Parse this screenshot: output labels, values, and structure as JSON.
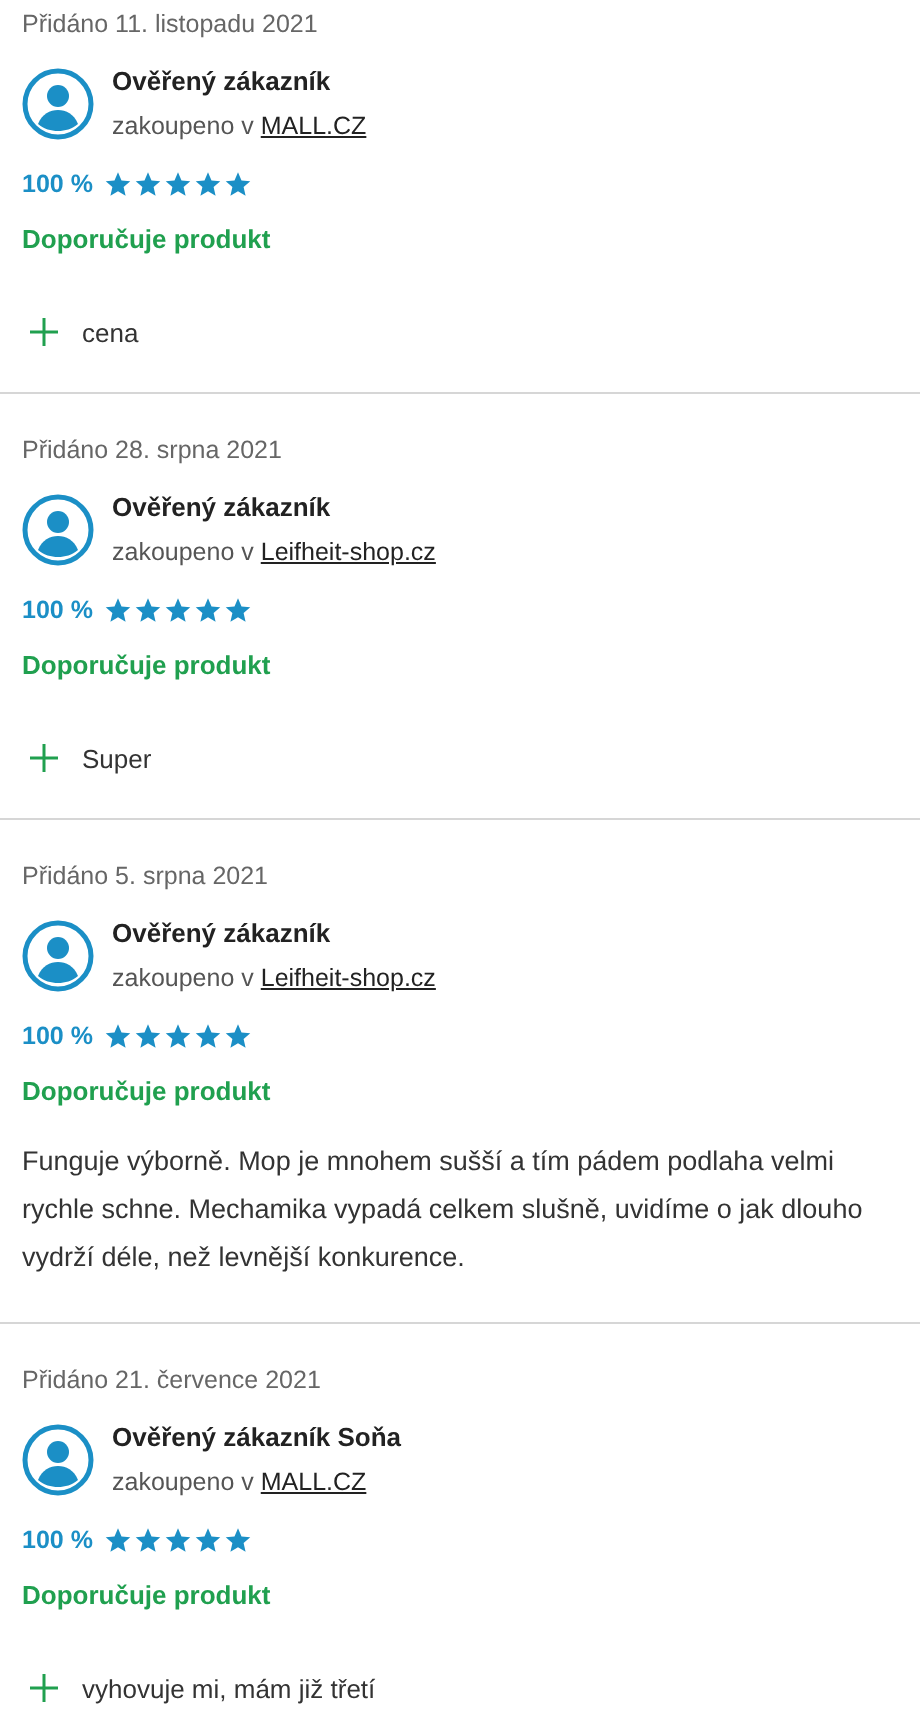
{
  "reviews": [
    {
      "date": "Přidáno 11. listopadu 2021",
      "author": "Ověřený zákazník",
      "purchased_prefix": "zakoupeno v",
      "shop": "MALL.CZ",
      "rating": "100 %",
      "stars": 5,
      "recommend": "Doporučuje produkt",
      "pros": [
        "cena"
      ]
    },
    {
      "date": "Přidáno 28. srpna 2021",
      "author": "Ověřený zákazník",
      "purchased_prefix": "zakoupeno v",
      "shop": "Leifheit-shop.cz",
      "rating": "100 %",
      "stars": 5,
      "recommend": "Doporučuje produkt",
      "pros": [
        "Super"
      ]
    },
    {
      "date": "Přidáno 5. srpna 2021",
      "author": "Ověřený zákazník",
      "purchased_prefix": "zakoupeno v",
      "shop": "Leifheit-shop.cz",
      "rating": "100 %",
      "stars": 5,
      "recommend": "Doporučuje produkt",
      "text": "Funguje výborně. Mop je mnohem sušší a tím pádem podlaha velmi rychle schne. Mechamika vypadá celkem slušně, uvidíme o jak dlouho vydrží déle, než levnější konkurence."
    },
    {
      "date": "Přidáno 21. července 2021",
      "author": "Ověřený zákazník Soňa",
      "purchased_prefix": "zakoupeno v",
      "shop": "MALL.CZ",
      "rating": "100 %",
      "stars": 5,
      "recommend": "Doporučuje produkt",
      "pros": [
        "vyhovuje mi, mám již třetí"
      ]
    }
  ]
}
